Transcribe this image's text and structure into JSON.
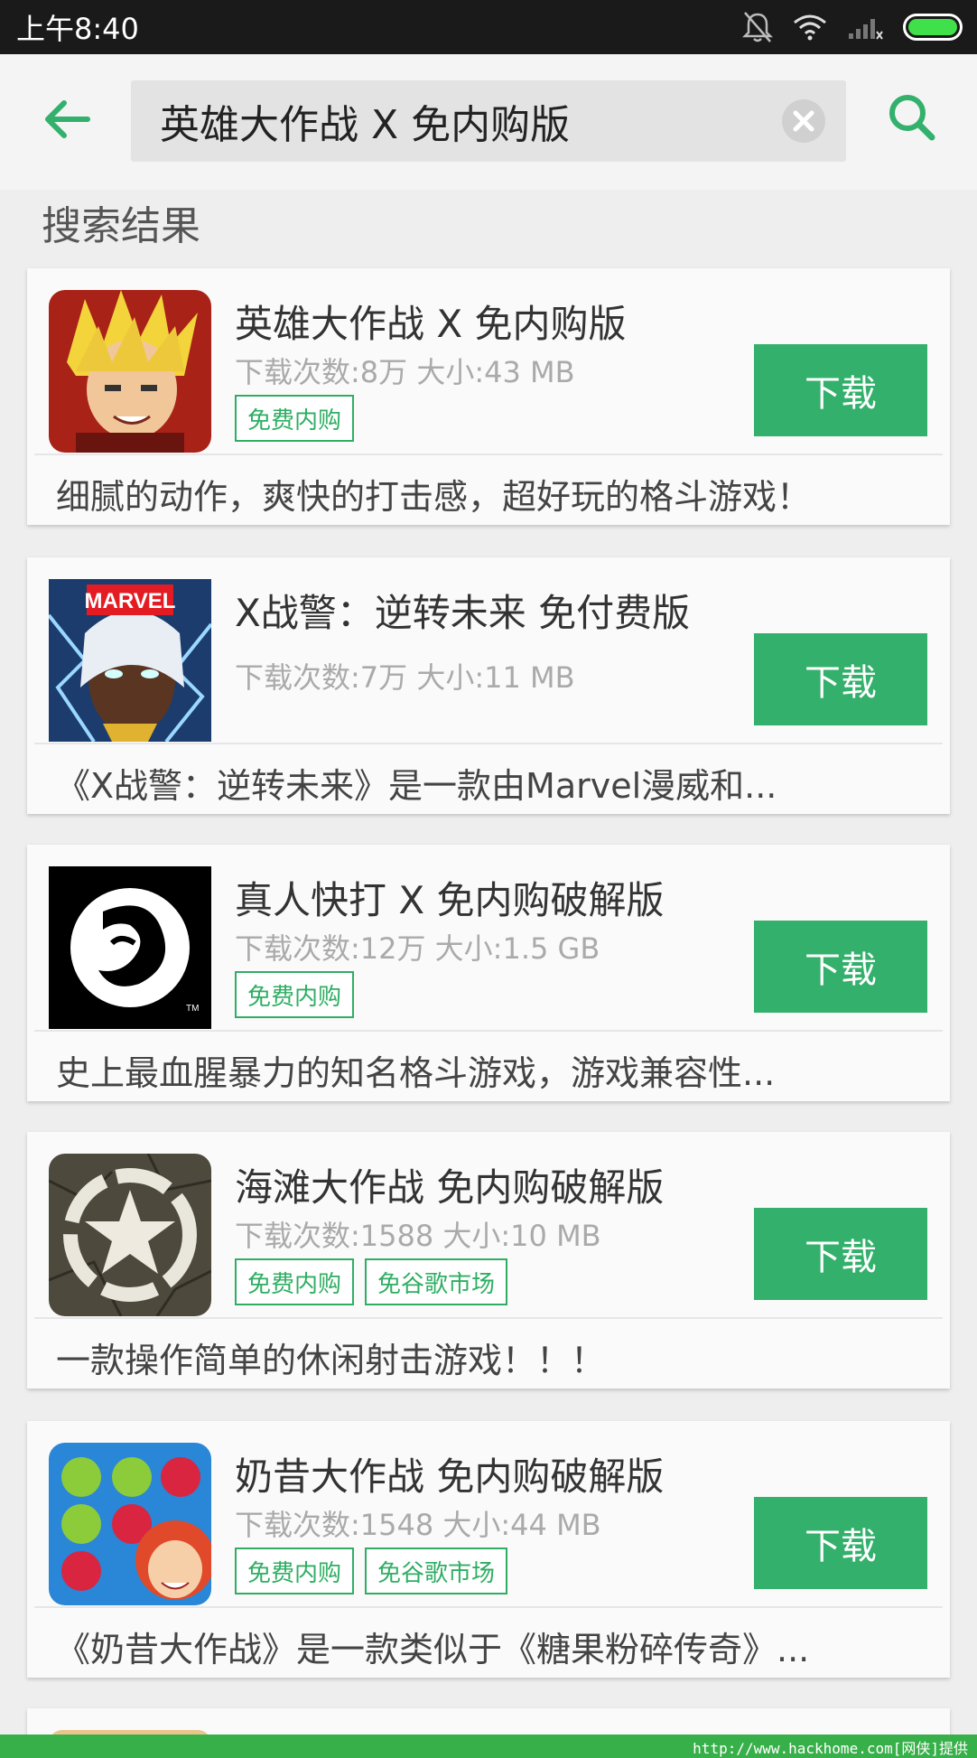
{
  "status": {
    "time": "上午8:40"
  },
  "search": {
    "query": "英雄大作战 X 免内购版"
  },
  "section_title": "搜索结果",
  "download_label": "下载",
  "results": [
    {
      "title": "英雄大作战 X 免内购版",
      "meta": "下载次数:8万 大小:43 MB",
      "tags": [
        "免费内购"
      ],
      "desc": "细腻的动作，爽快的打击感，超好玩的格斗游戏！"
    },
    {
      "title": "X战警：逆转未来 免付费版",
      "meta": "下载次数:7万 大小:11 MB",
      "tags": [],
      "desc": "《X战警：逆转未来》是一款由Marvel漫威和..."
    },
    {
      "title": "真人快打 X 免内购破解版",
      "meta": "下载次数:12万 大小:1.5 GB",
      "tags": [
        "免费内购"
      ],
      "desc": "史上最血腥暴力的知名格斗游戏，游戏兼容性..."
    },
    {
      "title": "海滩大作战 免内购破解版",
      "meta": "下载次数:1588 大小:10 MB",
      "tags": [
        "免费内购",
        "免谷歌市场"
      ],
      "desc": "一款操作简单的休闲射击游戏！！！"
    },
    {
      "title": "奶昔大作战  免内购破解版",
      "meta": "下载次数:1548 大小:44 MB",
      "tags": [
        "免费内购",
        "免谷歌市场"
      ],
      "desc": "《奶昔大作战》是一款类似于《糖果粉碎传奇》..."
    }
  ],
  "icons": [
    "back-arrow-icon",
    "clear-icon",
    "search-icon",
    "mute-bell-icon",
    "wifi-icon",
    "signal-icon",
    "battery-icon"
  ],
  "colors": {
    "accent": "#33b06b",
    "tag": "#2fae63",
    "statusbar": "#1a1a1a"
  },
  "watermark": "http://www.hackhome.com[网侠]提供"
}
